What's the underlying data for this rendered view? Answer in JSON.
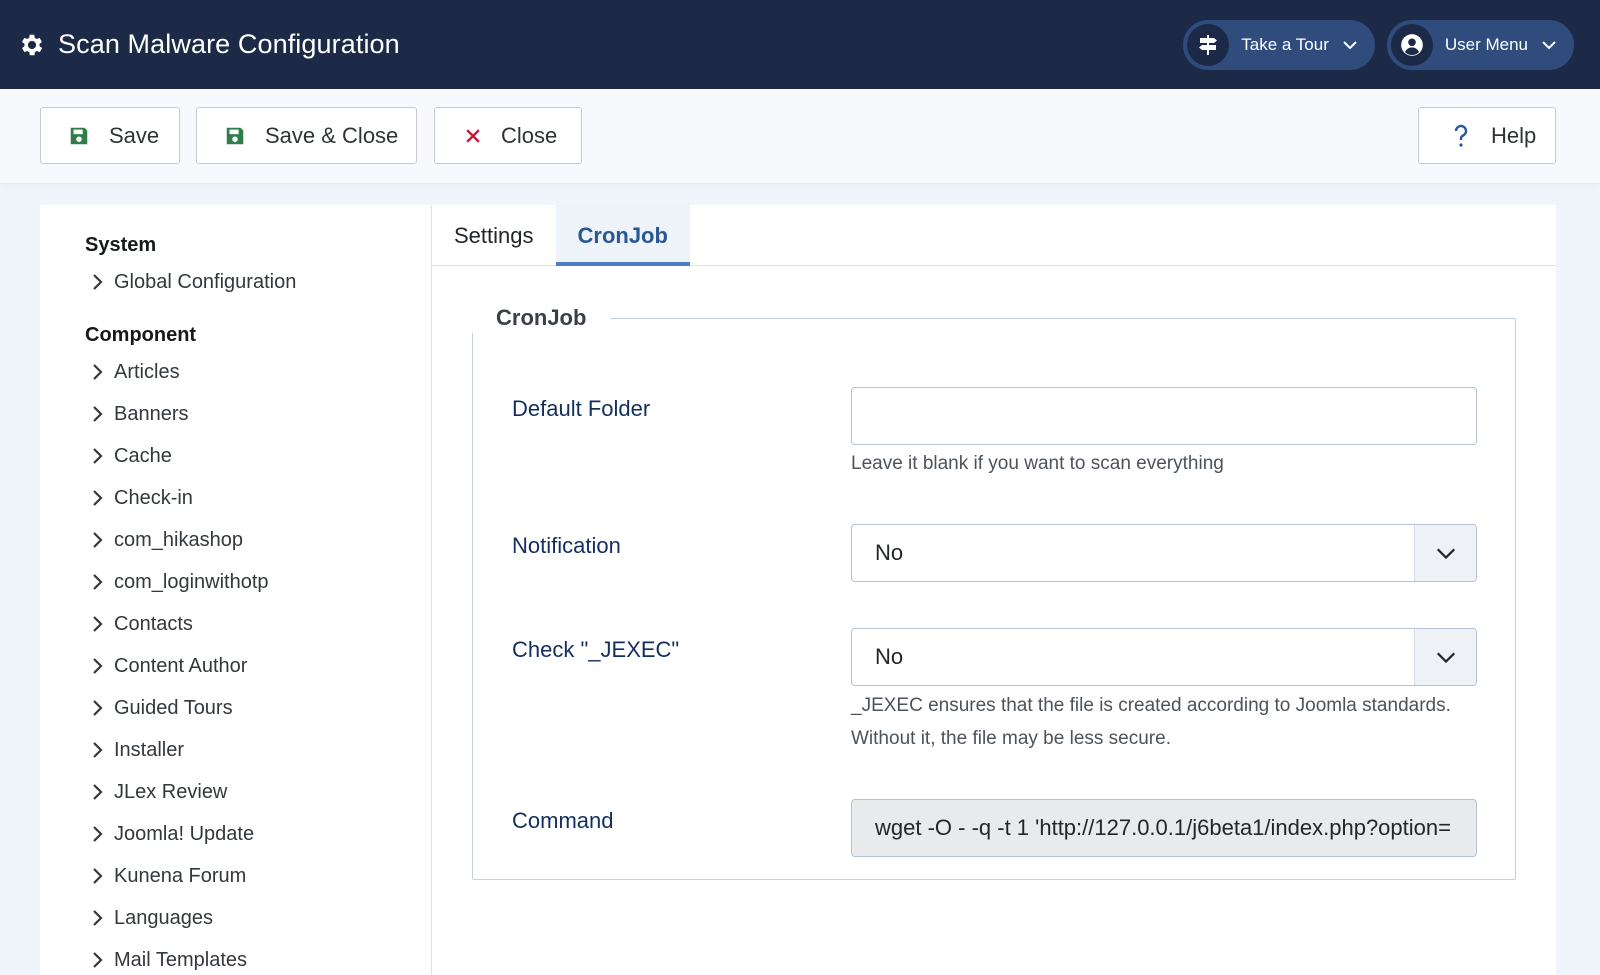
{
  "header": {
    "title": "Scan Malware Configuration",
    "tour_label": "Take a Tour",
    "user_menu_label": "User Menu"
  },
  "toolbar": {
    "save_label": "Save",
    "save_close_label": "Save & Close",
    "close_label": "Close",
    "help_label": "Help"
  },
  "sidebar": {
    "system_heading": "System",
    "system_items": [
      {
        "label": "Global Configuration"
      }
    ],
    "component_heading": "Component",
    "component_items": [
      {
        "label": "Articles"
      },
      {
        "label": "Banners"
      },
      {
        "label": "Cache"
      },
      {
        "label": "Check-in"
      },
      {
        "label": "com_hikashop"
      },
      {
        "label": "com_loginwithotp"
      },
      {
        "label": "Contacts"
      },
      {
        "label": "Content Author"
      },
      {
        "label": "Guided Tours"
      },
      {
        "label": "Installer"
      },
      {
        "label": "JLex Review"
      },
      {
        "label": "Joomla! Update"
      },
      {
        "label": "Kunena Forum"
      },
      {
        "label": "Languages"
      },
      {
        "label": "Mail Templates"
      }
    ]
  },
  "tabs": [
    {
      "label": "Settings",
      "active": false
    },
    {
      "label": "CronJob",
      "active": true
    }
  ],
  "form": {
    "legend": "CronJob",
    "default_folder": {
      "label": "Default Folder",
      "value": "",
      "hint": "Leave it blank if you want to scan everything"
    },
    "notification": {
      "label": "Notification",
      "value": "No"
    },
    "check_jexec": {
      "label": "Check \"_JEXEC\"",
      "value": "No",
      "hint_line1": "_JEXEC ensures that the file is created according to Joomla standards.",
      "hint_line2": "Without it, the file may be less secure."
    },
    "command": {
      "label": "Command",
      "value": "wget -O - -q -t 1 'http://127.0.0.1/j6beta1/index.php?option="
    }
  },
  "colors": {
    "header_bg": "#1c2a48",
    "pill_bg": "#2f4c7c",
    "save_icon": "#2e7d4a",
    "close_icon": "#c8102e",
    "help_icon": "#2a5895",
    "label_color": "#132f5e",
    "active_tab": "#2a5895"
  },
  "icons": {
    "header": "gear-icon",
    "tour": "signpost-icon",
    "user": "user-circle-icon",
    "save": "floppy-disk-icon",
    "close": "x-icon",
    "help": "question-icon",
    "sidebar_item": "chevron-right-icon",
    "select": "chevron-down-icon"
  }
}
